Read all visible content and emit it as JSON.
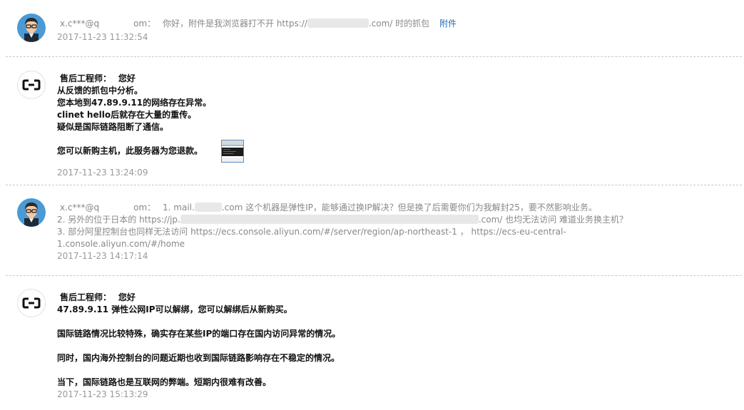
{
  "messages": [
    {
      "sender_prefix": "x.c***@q",
      "sender_suffix": "om：",
      "body_prefix": "你好，附件是我浏览器打不开 https://",
      "body_suffix": ".com/ 时的抓包",
      "attachment_label": "附件",
      "timestamp": "2017-11-23 11:32:54"
    },
    {
      "sender": "售后工程师：",
      "greeting": "您好",
      "lines": [
        "从反馈的抓包中分析。",
        "您本地到47.89.9.11的网络存在异常。",
        "clinet hello后就存在大量的重传。",
        "疑似是国际链路阻断了通信。",
        "您可以新购主机，此服务器为您退款。"
      ],
      "timestamp": "2017-11-23 13:24:09"
    },
    {
      "sender_prefix": "x.c***@q",
      "sender_suffix": "om：",
      "line1_prefix": "1. mail.",
      "line1_suffix": ".com 这个机器是弹性IP，能够通过换IP解决？但是换了后需要你们为我解封25，要不然影响业务。",
      "line2_prefix": "2. 另外的位于日本的 https://jp.",
      "line2_suffix": ".com/ 也均无法访问 难道业务换主机？",
      "line3": "3. 部分阿里控制台也同样无法访问 https://ecs.console.aliyun.com/#/server/region/ap-northeast-1 ， https://ecs-eu-central-",
      "line4": "1.console.aliyun.com/#/home",
      "timestamp": "2017-11-23 14:17:14"
    },
    {
      "sender": "售后工程师：",
      "greeting": "您好",
      "line1_ip": "47.89.9.11",
      "line1_rest": " 弹性公网IP可以解绑，您可以解绑后从新购买。",
      "para2": "国际链路情况比较特殊，确实存在某些IP的端口存在国内访问异常的情况。",
      "para3": "同时，国内海外控制台的问题近期也收到国际链路影响存在不稳定的情况。",
      "para4": "当下，国际链路也是互联网的弊端。短期内很难有改善。",
      "timestamp": "2017-11-23 15:13:29"
    }
  ]
}
